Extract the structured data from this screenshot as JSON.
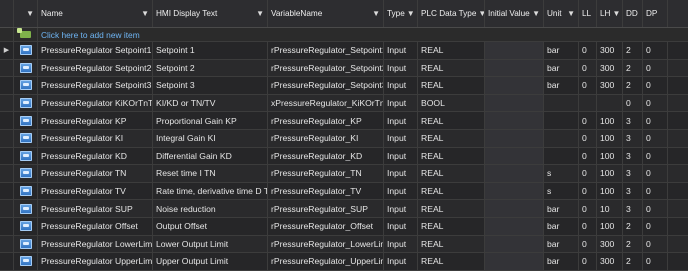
{
  "columns": [
    "Name",
    "HMI Display Text",
    "VariableName",
    "Type",
    "PLC Data Type",
    "Initial Value",
    "Unit",
    "LL",
    "LH",
    "DD",
    "DP"
  ],
  "add_row_text": "Click here to add new item",
  "rows": [
    {
      "name": "PressureRegulator Setpoint1",
      "hmi": "Setpoint 1",
      "var": "rPressureRegulator_Setpoint1",
      "type": "Input",
      "plc": "REAL",
      "init": "",
      "unit": "bar",
      "ll": "0",
      "lh": "300",
      "dd": "2",
      "dp": "0"
    },
    {
      "name": "PressureRegulator Setpoint2",
      "hmi": "Setpoint 2",
      "var": "rPressureRegulator_Setpoint2",
      "type": "Input",
      "plc": "REAL",
      "init": "",
      "unit": "bar",
      "ll": "0",
      "lh": "300",
      "dd": "2",
      "dp": "0"
    },
    {
      "name": "PressureRegulator Setpoint3",
      "hmi": "Setpoint 3",
      "var": "rPressureRegulator_Setpoint3",
      "type": "Input",
      "plc": "REAL",
      "init": "",
      "unit": "bar",
      "ll": "0",
      "lh": "300",
      "dd": "2",
      "dp": "0"
    },
    {
      "name": "PressureRegulator KiKOrTnTv",
      "hmi": "KI/KD or TN/TV",
      "var": "xPressureRegulator_KiKOrTnTv",
      "type": "Input",
      "plc": "BOOL",
      "init": "",
      "unit": "",
      "ll": "",
      "lh": "",
      "dd": "0",
      "dp": "0"
    },
    {
      "name": "PressureRegulator KP",
      "hmi": "Proportional Gain KP",
      "var": "rPressureRegulator_KP",
      "type": "Input",
      "plc": "REAL",
      "init": "",
      "unit": "",
      "ll": "0",
      "lh": "100",
      "dd": "3",
      "dp": "0"
    },
    {
      "name": "PressureRegulator KI",
      "hmi": "Integral Gain KI",
      "var": "rPressureRegulator_KI",
      "type": "Input",
      "plc": "REAL",
      "init": "",
      "unit": "",
      "ll": "0",
      "lh": "100",
      "dd": "3",
      "dp": "0"
    },
    {
      "name": "PressureRegulator KD",
      "hmi": "Differential Gain KD",
      "var": "rPressureRegulator_KD",
      "type": "Input",
      "plc": "REAL",
      "init": "",
      "unit": "",
      "ll": "0",
      "lh": "100",
      "dd": "3",
      "dp": "0"
    },
    {
      "name": "PressureRegulator TN",
      "hmi": "Reset time I TN",
      "var": "rPressureRegulator_TN",
      "type": "Input",
      "plc": "REAL",
      "init": "",
      "unit": "s",
      "ll": "0",
      "lh": "100",
      "dd": "3",
      "dp": "0"
    },
    {
      "name": "PressureRegulator TV",
      "hmi": "Rate time, derivative time D TV",
      "var": "rPressureRegulator_TV",
      "type": "Input",
      "plc": "REAL",
      "init": "",
      "unit": "s",
      "ll": "0",
      "lh": "100",
      "dd": "3",
      "dp": "0"
    },
    {
      "name": "PressureRegulator SUP",
      "hmi": "Noise reduction",
      "var": "rPressureRegulator_SUP",
      "type": "Input",
      "plc": "REAL",
      "init": "",
      "unit": "bar",
      "ll": "0",
      "lh": "10",
      "dd": "3",
      "dp": "0"
    },
    {
      "name": "PressureRegulator Offset",
      "hmi": "Output Offset",
      "var": "rPressureRegulator_Offset",
      "type": "Input",
      "plc": "REAL",
      "init": "",
      "unit": "bar",
      "ll": "0",
      "lh": "100",
      "dd": "2",
      "dp": "0"
    },
    {
      "name": "PressureRegulator LowerLimit",
      "hmi": "Lower Output Limit",
      "var": "rPressureRegulator_LowerLimit",
      "type": "Input",
      "plc": "REAL",
      "init": "",
      "unit": "bar",
      "ll": "0",
      "lh": "300",
      "dd": "2",
      "dp": "0"
    },
    {
      "name": "PressureRegulator UpperLimit",
      "hmi": "Upper Output Limit",
      "var": "rPressureRegulator_UpperLimit",
      "type": "Input",
      "plc": "REAL",
      "init": "",
      "unit": "bar",
      "ll": "0",
      "lh": "300",
      "dd": "2",
      "dp": "0"
    }
  ]
}
